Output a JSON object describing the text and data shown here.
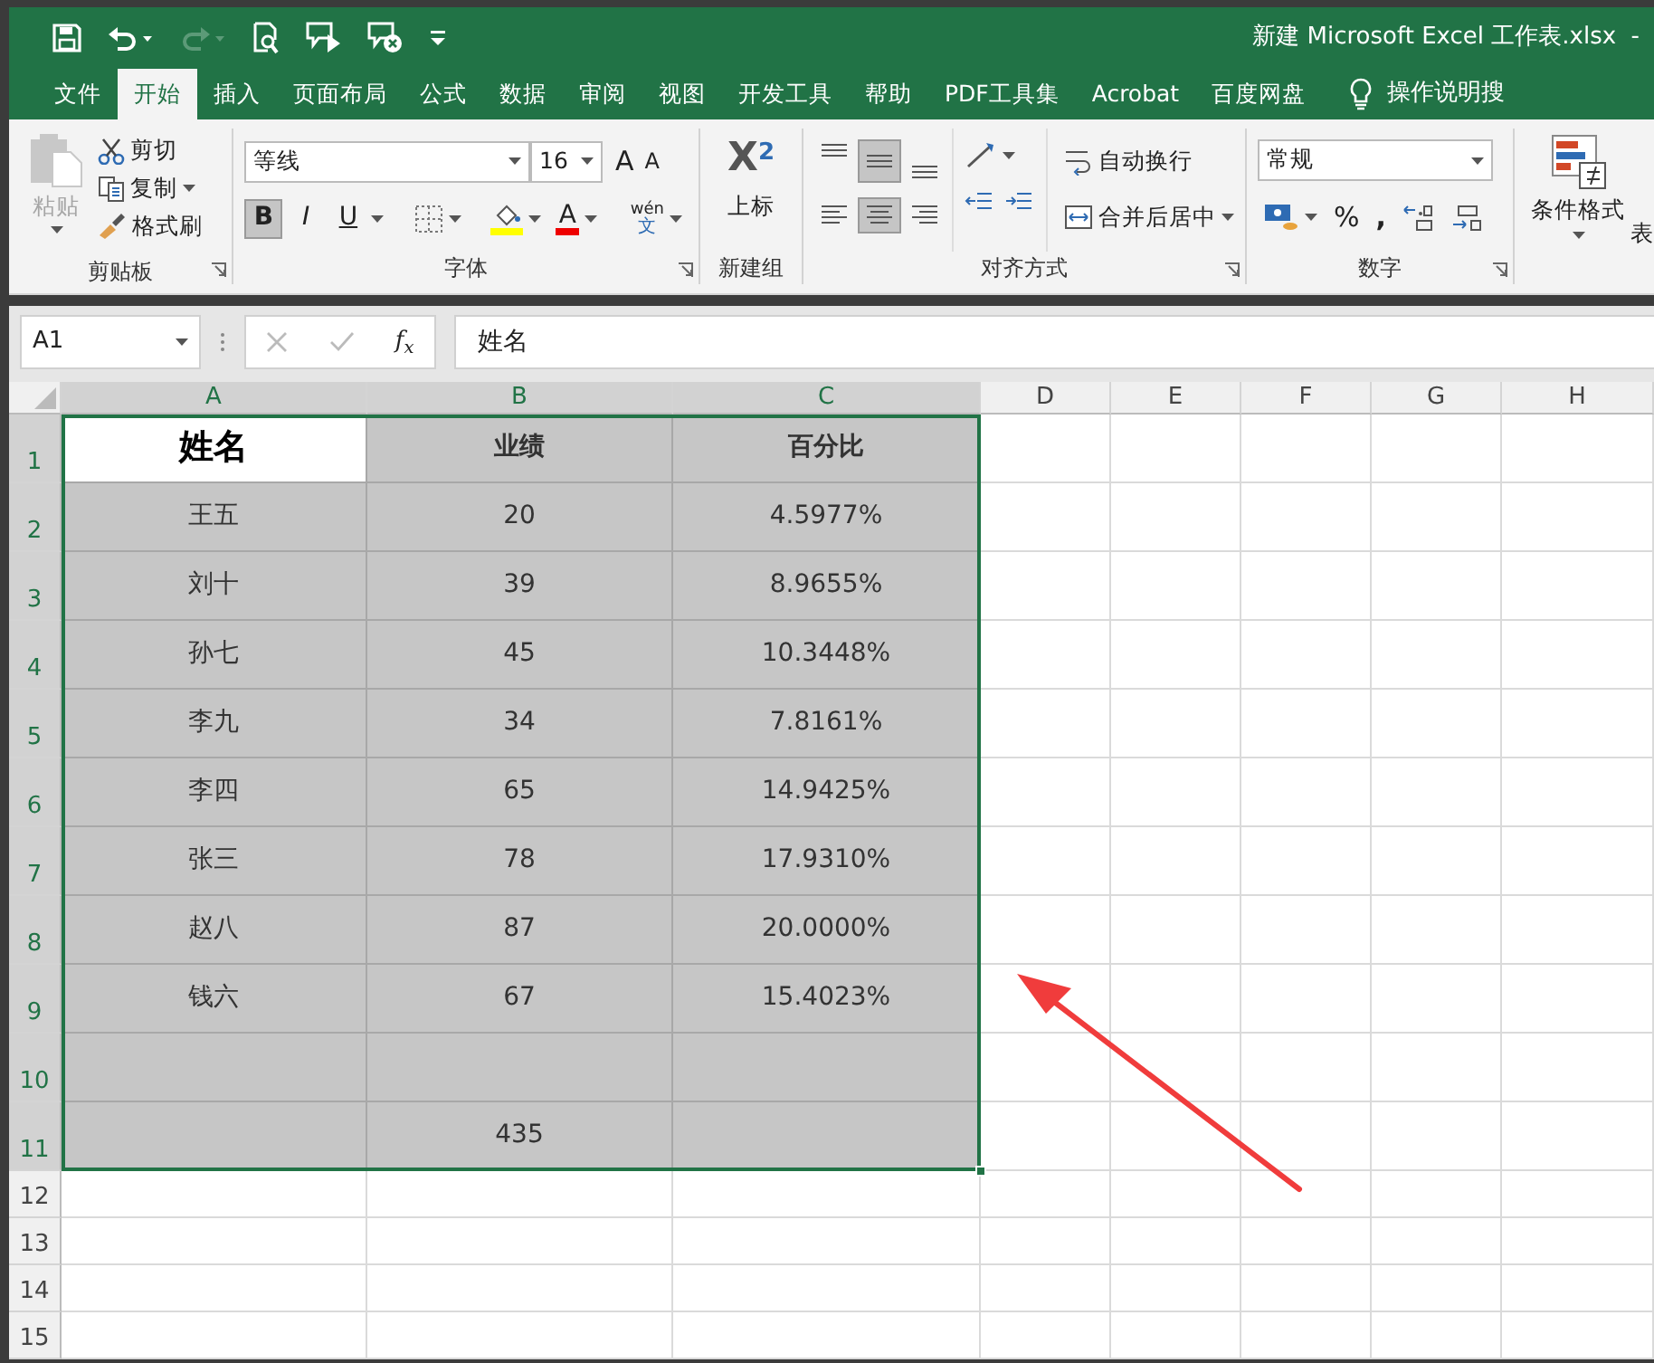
{
  "quick_access": [
    {
      "kind": "save",
      "disabled": false
    },
    {
      "kind": "undo",
      "disabled": false
    },
    {
      "kind": "redo",
      "disabled": true
    },
    {
      "kind": "preview",
      "disabled": false
    },
    {
      "kind": "comment-play",
      "disabled": false
    },
    {
      "kind": "comment-delete",
      "disabled": false
    },
    {
      "kind": "customize",
      "disabled": false
    }
  ],
  "window": {
    "title": "新建 Microsoft Excel 工作表.xlsx  -"
  },
  "tabs": [
    {
      "label": "文件",
      "selected": false
    },
    {
      "label": "开始",
      "selected": true
    },
    {
      "label": "插入",
      "selected": false
    },
    {
      "label": "页面布局",
      "selected": false
    },
    {
      "label": "公式",
      "selected": false
    },
    {
      "label": "数据",
      "selected": false
    },
    {
      "label": "审阅",
      "selected": false
    },
    {
      "label": "视图",
      "selected": false
    },
    {
      "label": "开发工具",
      "selected": false
    },
    {
      "label": "帮助",
      "selected": false
    },
    {
      "label": "PDF工具集",
      "selected": false
    },
    {
      "label": "Acrobat",
      "selected": false
    },
    {
      "label": "百度网盘",
      "selected": false
    }
  ],
  "search_hint": "操作说明搜",
  "ribbon": {
    "clipboard": {
      "paste": "粘贴",
      "paste_disabled": true,
      "cut": "剪切",
      "copy": "复制",
      "format_painter": "格式刷",
      "label": "剪贴板"
    },
    "font": {
      "font_name": "等线",
      "font_size": "16",
      "grow": "A",
      "shrink": "A",
      "styles": [
        {
          "kind": "bold",
          "label": "B",
          "pressed": true
        },
        {
          "kind": "italic",
          "label": "I",
          "pressed": false
        },
        {
          "kind": "underline",
          "label": "U",
          "pressed": false
        }
      ],
      "font_color": "A",
      "phonetic": "wén",
      "phonetic_char": "文",
      "label": "字体"
    },
    "new_group": {
      "icon": "X$^{2}$",
      "superscript": "上标",
      "label": "新建组"
    },
    "alignment": {
      "vertical": [
        {
          "pressed": false
        },
        {
          "pressed": true
        },
        {
          "pressed": false
        }
      ],
      "horizontal": [
        {
          "pressed": false
        },
        {
          "pressed": true
        },
        {
          "pressed": false
        }
      ],
      "wrap_text": "自动换行",
      "merge_center": "合并后居中",
      "label": "对齐方式"
    },
    "number": {
      "format": "常规",
      "percent": "%",
      "comma": ",",
      "label": "数字"
    },
    "styles": {
      "conditional_formatting": "条件格式",
      "table_format": "表"
    }
  },
  "formula_bar": {
    "name_box": "A1",
    "fx": "f$_{x}$",
    "formula": "姓名"
  },
  "sheet": {
    "columns": [
      {
        "label": "A",
        "selected": true
      },
      {
        "label": "B",
        "selected": true
      },
      {
        "label": "C",
        "selected": true
      },
      {
        "label": "D",
        "selected": false
      },
      {
        "label": "E",
        "selected": false
      },
      {
        "label": "F",
        "selected": false
      },
      {
        "label": "G",
        "selected": false
      },
      {
        "label": "H",
        "selected": false
      }
    ],
    "rows": [
      {
        "label": "1",
        "selected": true,
        "header": true,
        "cells": [
          {
            "text": "姓名",
            "active": true
          },
          {
            "text": "业绩",
            "active": false
          },
          {
            "text": "百分比",
            "active": false
          }
        ]
      },
      {
        "label": "2",
        "selected": true,
        "header": false,
        "cells": [
          {
            "text": "王五",
            "active": false
          },
          {
            "text": "20",
            "active": false
          },
          {
            "text": "4.5977%",
            "active": false
          }
        ]
      },
      {
        "label": "3",
        "selected": true,
        "header": false,
        "cells": [
          {
            "text": "刘十",
            "active": false
          },
          {
            "text": "39",
            "active": false
          },
          {
            "text": "8.9655%",
            "active": false
          }
        ]
      },
      {
        "label": "4",
        "selected": true,
        "header": false,
        "cells": [
          {
            "text": "孙七",
            "active": false
          },
          {
            "text": "45",
            "active": false
          },
          {
            "text": "10.3448%",
            "active": false
          }
        ]
      },
      {
        "label": "5",
        "selected": true,
        "header": false,
        "cells": [
          {
            "text": "李九",
            "active": false
          },
          {
            "text": "34",
            "active": false
          },
          {
            "text": "7.8161%",
            "active": false
          }
        ]
      },
      {
        "label": "6",
        "selected": true,
        "header": false,
        "cells": [
          {
            "text": "李四",
            "active": false
          },
          {
            "text": "65",
            "active": false
          },
          {
            "text": "14.9425%",
            "active": false
          }
        ]
      },
      {
        "label": "7",
        "selected": true,
        "header": false,
        "cells": [
          {
            "text": "张三",
            "active": false
          },
          {
            "text": "78",
            "active": false
          },
          {
            "text": "17.9310%",
            "active": false
          }
        ]
      },
      {
        "label": "8",
        "selected": true,
        "header": false,
        "cells": [
          {
            "text": "赵八",
            "active": false
          },
          {
            "text": "87",
            "active": false
          },
          {
            "text": "20.0000%",
            "active": false
          }
        ]
      },
      {
        "label": "9",
        "selected": true,
        "header": false,
        "cells": [
          {
            "text": "钱六",
            "active": false
          },
          {
            "text": "67",
            "active": false
          },
          {
            "text": "15.4023%",
            "active": false
          }
        ]
      },
      {
        "label": "10",
        "selected": true,
        "header": false,
        "cells": [
          {
            "active": false
          },
          {
            "active": false
          },
          {
            "active": false
          }
        ]
      },
      {
        "label": "11",
        "selected": true,
        "header": false,
        "cells": [
          {
            "active": false
          },
          {
            "text": "435",
            "active": false
          },
          {
            "active": false
          }
        ]
      },
      {
        "label": "12",
        "selected": false,
        "cells": []
      },
      {
        "label": "13",
        "selected": false,
        "cells": []
      },
      {
        "label": "14",
        "selected": false,
        "cells": []
      },
      {
        "label": "15",
        "selected": false,
        "cells": []
      }
    ]
  }
}
